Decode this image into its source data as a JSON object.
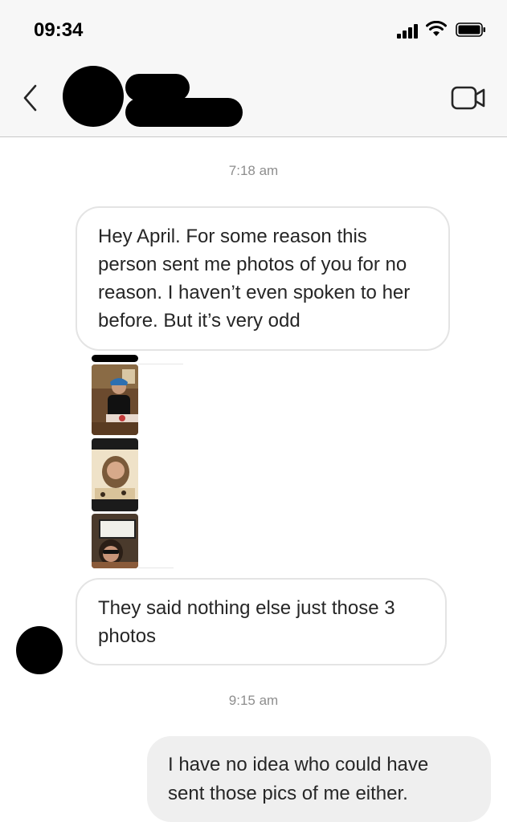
{
  "status_bar": {
    "time": "09:34"
  },
  "thread": {
    "messages": [
      {
        "timestamp": "7:18 am"
      },
      {
        "text": "Hey April. For some reason this person sent me photos of you for no reason. I haven’t even spoken to her before. But it’s very odd"
      },
      {
        "text": "They said nothing else just those 3 photos"
      },
      {
        "timestamp": "9:15 am"
      },
      {
        "text": "I have no idea who could have sent those pics of me either."
      }
    ]
  },
  "colors": {
    "header_bg": "#f7f7f7",
    "incoming_border": "#e4e4e4",
    "outgoing_bg": "#efefef",
    "timestamp": "#8e8e8e"
  }
}
